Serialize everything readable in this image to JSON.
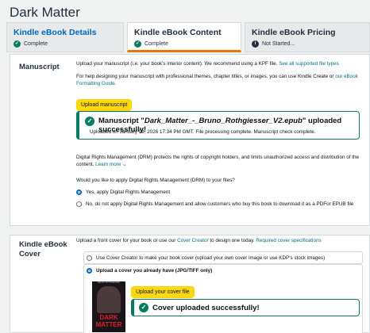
{
  "page_title": "Dark Matter",
  "tabs": [
    {
      "title": "Kindle eBook Details",
      "status": "Complete"
    },
    {
      "title": "Kindle eBook Content",
      "status": "Complete"
    },
    {
      "title": "Kindle eBook Pricing",
      "status": "Not Started..."
    }
  ],
  "manuscript": {
    "label": "Manuscript",
    "intro": "Upload your manuscript (i.e. your book's interior content). We recommend using a KPF file.",
    "intro_link": "See all supported file types",
    "help": "For help designing your manuscript with professional themes, chapter titles, or images, you can use Kindle Create or",
    "help_link": "our eBook Formatting Guide.",
    "upload_btn": "Upload manuscript",
    "alert_prefix": "Manuscript \"",
    "alert_file": "Dark_Matter_-_Bruno_Rothgiesser_V2.epub",
    "alert_suffix": "\" uploaded successfully!",
    "alert_sub": "Uploaded on January 09, 2026 17:34 PM GMT. File processing complete. Manuscript check complete.",
    "drm_text": "Digital Rights Management (DRM) protects the rights of copyright holders, and limits unauthorized access and distribution of the content.",
    "drm_link": "Learn more",
    "drm_question": "Would you like to apply Digital Rights Management (DRM) to your files?",
    "drm_yes": "Yes, apply Digital Rights Management",
    "drm_no": "No, do not apply Digital Rights Management and allow customers who buy this book to download it as a PDFor EPUB file"
  },
  "cover": {
    "label_line1": "Kindle eBook",
    "label_line2": "Cover",
    "intro_pre": "Upload a front cover for your book or use our",
    "intro_link1": "Cover Creator",
    "intro_mid": "to design one today.",
    "intro_link2": "Required cover specifications",
    "opt1": "Use Cover Creator to make your book cover (upload your own cover image or use KDP's stock images)",
    "opt2": "Upload a cover you already have (JPG/TIFF only)",
    "upload_btn": "Upload your cover file",
    "success": "Cover uploaded successfully!",
    "thumb_author": "BRUNO ROTHGIESSER",
    "thumb_title1": "DARK",
    "thumb_title2": "MATTER"
  },
  "colors": {
    "accent": "#067d62",
    "button": "#ffd814",
    "link": "#007185",
    "active_tab": "#e77600"
  }
}
